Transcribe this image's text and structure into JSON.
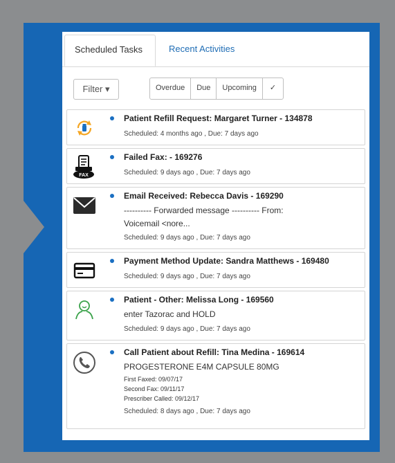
{
  "tabs": {
    "scheduled": "Scheduled Tasks",
    "recent": "Recent Activities"
  },
  "toolbar": {
    "filter_label": "Filter ▾",
    "segments": [
      "Overdue",
      "Due",
      "Upcoming",
      "✓"
    ]
  },
  "tasks": [
    {
      "title": "Patient Refill Request: Margaret Turner - 134878",
      "schedule": "Scheduled: 4 months ago , Due: 7 days ago",
      "icon": "refill-icon"
    },
    {
      "title": "Failed Fax: - 169276",
      "schedule": "Scheduled: 9 days ago , Due: 7 days ago",
      "icon": "fax-icon",
      "icon_text": "FAX"
    },
    {
      "title": "Email Received: Rebecca Davis - 169290",
      "body1": "---------- Forwarded message ---------- From:",
      "body2": "Voicemail <nore...",
      "schedule": "Scheduled: 9 days ago , Due: 7 days ago",
      "icon": "envelope-icon"
    },
    {
      "title": "Payment Method Update: Sandra Matthews - 169480",
      "schedule": "Scheduled: 9 days ago , Due: 7 days ago",
      "icon": "credit-card-icon"
    },
    {
      "title": "Patient - Other: Melissa Long - 169560",
      "body1": "enter Tazorac and HOLD",
      "schedule": "Scheduled: 9 days ago , Due: 7 days ago",
      "icon": "patient-icon"
    },
    {
      "title": "Call Patient about Refill: Tina Medina - 169614",
      "body1": "PROGESTERONE E4M CAPSULE 80MG",
      "detail1": "First Faxed: 09/07/17",
      "detail2": "Second Fax: 09/11/17",
      "detail3": "Prescriber Called: 09/12/17",
      "schedule": "Scheduled: 8 days ago , Due: 7 days ago",
      "icon": "phone-icon"
    }
  ],
  "colors": {
    "accent": "#1666b4",
    "dot": "#1a6fc2",
    "patient_icon": "#3aa24a",
    "refill_icon": "#f5a623"
  }
}
